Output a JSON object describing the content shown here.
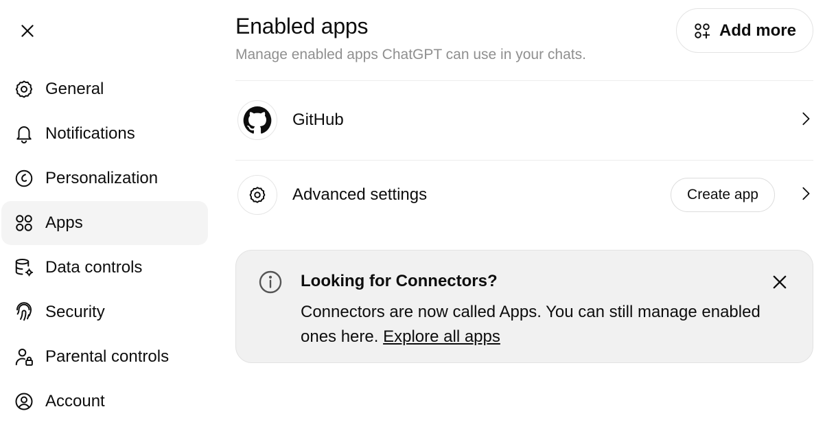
{
  "sidebar": {
    "close_icon": "close-icon",
    "items": [
      {
        "label": "General",
        "icon": "gear-icon"
      },
      {
        "label": "Notifications",
        "icon": "bell-icon"
      },
      {
        "label": "Personalization",
        "icon": "personalization-icon"
      },
      {
        "label": "Apps",
        "icon": "apps-grid-icon",
        "active": true
      },
      {
        "label": "Data controls",
        "icon": "database-gear-icon"
      },
      {
        "label": "Security",
        "icon": "fingerprint-icon"
      },
      {
        "label": "Parental controls",
        "icon": "user-lock-icon"
      },
      {
        "label": "Account",
        "icon": "user-circle-icon"
      }
    ]
  },
  "main": {
    "title": "Enabled apps",
    "subtitle": "Manage enabled apps ChatGPT can use in your chats.",
    "add_more_label": "Add more",
    "apps": [
      {
        "label": "GitHub",
        "icon": "github-icon"
      }
    ],
    "advanced": {
      "label": "Advanced settings",
      "icon": "gear-icon",
      "create_app_label": "Create app"
    },
    "notice": {
      "title": "Looking for Connectors?",
      "body": "Connectors are now called Apps. You can still manage enabled ones here.",
      "link": "Explore all apps"
    }
  }
}
